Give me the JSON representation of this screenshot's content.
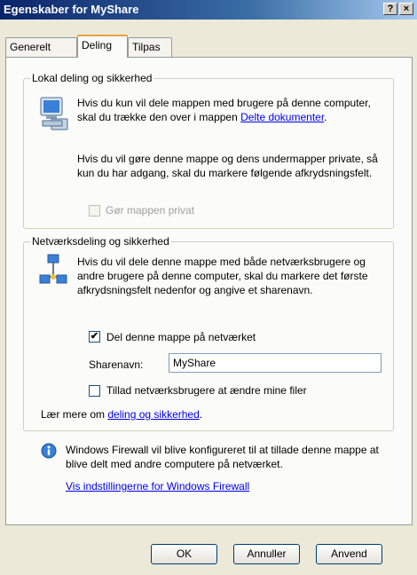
{
  "window": {
    "title": "Egenskaber for MyShare",
    "help_button": "?",
    "close_button": "×"
  },
  "tabs": [
    {
      "label": "Generelt"
    },
    {
      "label": "Deling"
    },
    {
      "label": "Tilpas"
    }
  ],
  "local_sharing": {
    "legend": "Lokal deling og sikkerhed",
    "paragraph1_prefix": "Hvis du kun vil dele mappen med brugere på denne computer, skal du trække den over i mappen ",
    "paragraph1_link": "Delte dokumenter",
    "paragraph1_suffix": ".",
    "paragraph2": "Hvis du vil gøre denne mappe og dens undermapper private, så kun du har adgang, skal du markere følgende afkrydsningsfelt.",
    "private_checkbox_label": "Gør mappen privat",
    "private_checked": false
  },
  "network_sharing": {
    "legend": "Netværksdeling og sikkerhed",
    "paragraph": "Hvis du vil dele denne mappe med både netværksbrugere og andre brugere på denne computer, skal du markere det første afkrydsningsfelt nedenfor og angive et sharenavn.",
    "share_checkbox_label": "Del denne mappe på netværket",
    "share_checked": true,
    "sharename_label": "Sharenavn:",
    "sharename_value": "MyShare",
    "allow_change_label": "Tillad netværksbrugere at ændre mine filer",
    "allow_change_checked": false,
    "learn_prefix": "Lær mere om ",
    "learn_link": "deling og sikkerhed",
    "learn_suffix": "."
  },
  "firewall": {
    "text": "Windows Firewall vil blive konfigureret til at tillade denne mappe at blive delt med andre computere på netværket.",
    "link": "Vis indstillingerne for Windows Firewall"
  },
  "buttons": {
    "ok": "OK",
    "cancel": "Annuller",
    "apply": "Anvend"
  },
  "colors": {
    "titlebar": "#0a246a",
    "link": "#0000ee",
    "tab_highlight": "#e6a23c"
  }
}
